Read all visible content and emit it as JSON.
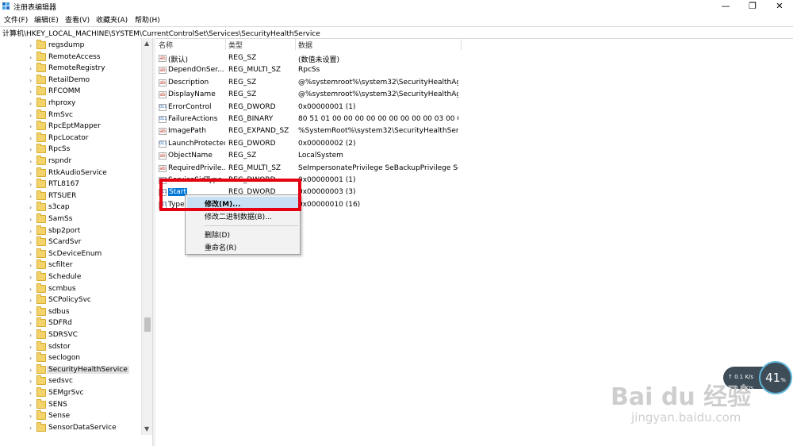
{
  "window": {
    "title": "注册表编辑器",
    "min": "—",
    "max": "❐",
    "close": "✕"
  },
  "menu": [
    "文件(F)",
    "编辑(E)",
    "查看(V)",
    "收藏夹(A)",
    "帮助(H)"
  ],
  "address": "计算机\\HKEY_LOCAL_MACHINE\\SYSTEM\\CurrentControlSet\\Services\\SecurityHealthService",
  "tree": {
    "items": [
      "regsdump",
      "RemoteAccess",
      "RemoteRegistry",
      "RetailDemo",
      "RFCOMM",
      "rhproxy",
      "RmSvc",
      "RpcEptMapper",
      "RpcLocator",
      "RpcSs",
      "rspndr",
      "RtkAudioService",
      "RTL8167",
      "RTSUER",
      "s3cap",
      "SamSs",
      "sbp2port",
      "SCardSvr",
      "ScDeviceEnum",
      "scfilter",
      "Schedule",
      "scmbus",
      "SCPolicySvc",
      "sdbus",
      "SDFRd",
      "SDRSVC",
      "sdstor",
      "seclogon",
      "SecurityHealthService",
      "sedsvc",
      "SEMgrSvc",
      "SENS",
      "Sense",
      "SensorDataService"
    ],
    "expander": "›"
  },
  "columns": {
    "name": "名称",
    "type": "类型",
    "data": "数据"
  },
  "values": [
    {
      "icon": "ab",
      "name": "(默认)",
      "type": "REG_SZ",
      "data": "(数值未设置)"
    },
    {
      "icon": "ab",
      "name": "DependOnSer...",
      "type": "REG_MULTI_SZ",
      "data": "RpcSs"
    },
    {
      "icon": "ab",
      "name": "Description",
      "type": "REG_SZ",
      "data": "@%systemroot%\\system32\\SecurityHealthAg..."
    },
    {
      "icon": "ab",
      "name": "DisplayName",
      "type": "REG_SZ",
      "data": "@%systemroot%\\system32\\SecurityHealthAg..."
    },
    {
      "icon": "011",
      "name": "ErrorControl",
      "type": "REG_DWORD",
      "data": "0x00000001 (1)"
    },
    {
      "icon": "011",
      "name": "FailureActions",
      "type": "REG_BINARY",
      "data": "80 51 01 00 00 00 00 00 00 00 00 00 03 00 00..."
    },
    {
      "icon": "ab",
      "name": "ImagePath",
      "type": "REG_EXPAND_SZ",
      "data": "%SystemRoot%\\system32\\SecurityHealthServi..."
    },
    {
      "icon": "011",
      "name": "LaunchProtected",
      "type": "REG_DWORD",
      "data": "0x00000002 (2)"
    },
    {
      "icon": "ab",
      "name": "ObjectName",
      "type": "REG_SZ",
      "data": "LocalSystem"
    },
    {
      "icon": "ab",
      "name": "RequiredPrivile...",
      "type": "REG_MULTI_SZ",
      "data": "SeImpersonatePrivilege SeBackupPrivilege Se..."
    },
    {
      "icon": "011",
      "name": "ServiceSidType",
      "type": "REG_DWORD",
      "data": "0x00000001 (1)"
    },
    {
      "icon": "011",
      "name": "Start",
      "type": "REG_DWORD",
      "data": "0x00000003 (3)"
    },
    {
      "icon": "011",
      "name": "Type",
      "type": "REG_DWORD",
      "data": "0x00000010 (16)"
    }
  ],
  "context_menu": [
    "修改(M)...",
    "修改二进制数据(B)...",
    "删除(D)",
    "重命名(R)"
  ],
  "network": {
    "up": "↑ 0.1 K/s",
    "down": "↓ 0.1 K/s",
    "percent": "41",
    "unit": "%"
  },
  "watermark": {
    "logo": "Bai du 经验",
    "url": "jingyan.baidu.com"
  }
}
